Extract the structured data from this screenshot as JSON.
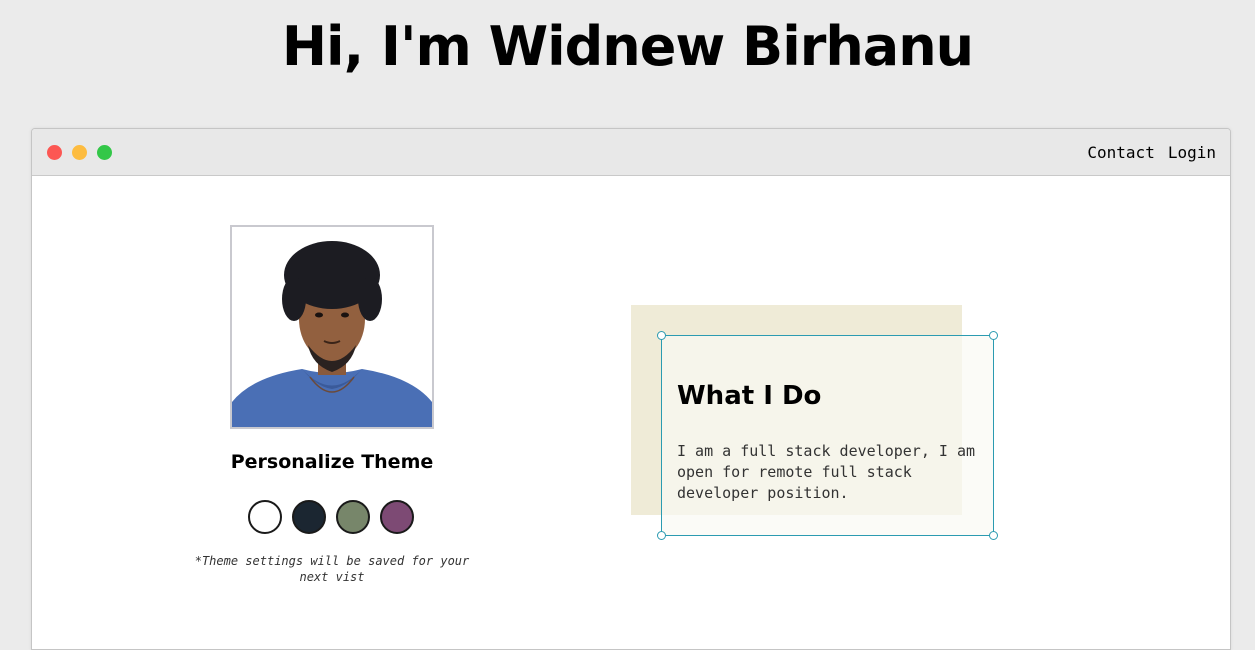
{
  "header": {
    "title": "Hi, I'm Widnew Birhanu"
  },
  "window": {
    "nav": {
      "contact": "Contact",
      "login": "Login"
    }
  },
  "profile": {
    "theme_heading": "Personalize Theme",
    "theme_note": "*Theme settings will be saved for your next vist",
    "swatches": [
      {
        "name": "white",
        "color": "#ffffff"
      },
      {
        "name": "dark-navy",
        "color": "#1b2631"
      },
      {
        "name": "olive-green",
        "color": "#77866a"
      },
      {
        "name": "plum",
        "color": "#7d4a74"
      }
    ]
  },
  "card": {
    "title": "What I Do",
    "body": "I am a full stack developer, I am open for remote full stack developer position."
  },
  "colors": {
    "page_background": "#ebebeb",
    "window_background": "#ffffff",
    "title_bar": "#e8e8e8",
    "card_back": "#efebd7",
    "selection_outline": "#2b9bb1",
    "traffic_red": "#fc5753",
    "traffic_yellow": "#fdbc40",
    "traffic_green": "#33c748"
  }
}
